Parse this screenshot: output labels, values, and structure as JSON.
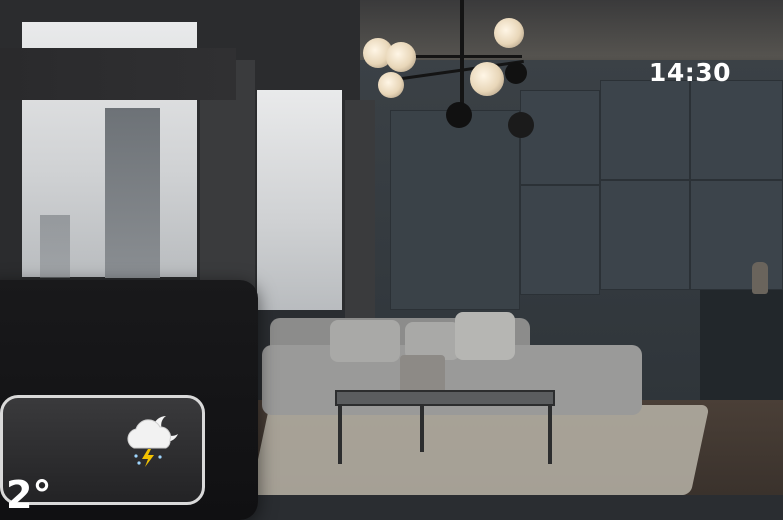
{
  "widget": {
    "time": "14:30",
    "weather_icon": "partly-cloudy-night-thunder-icon",
    "temperature_partial": "2°"
  },
  "colors": {
    "widget_background": "#141416",
    "card_border": "#d9d9d9",
    "text": "#ffffff",
    "lightning": "#f2c200"
  }
}
